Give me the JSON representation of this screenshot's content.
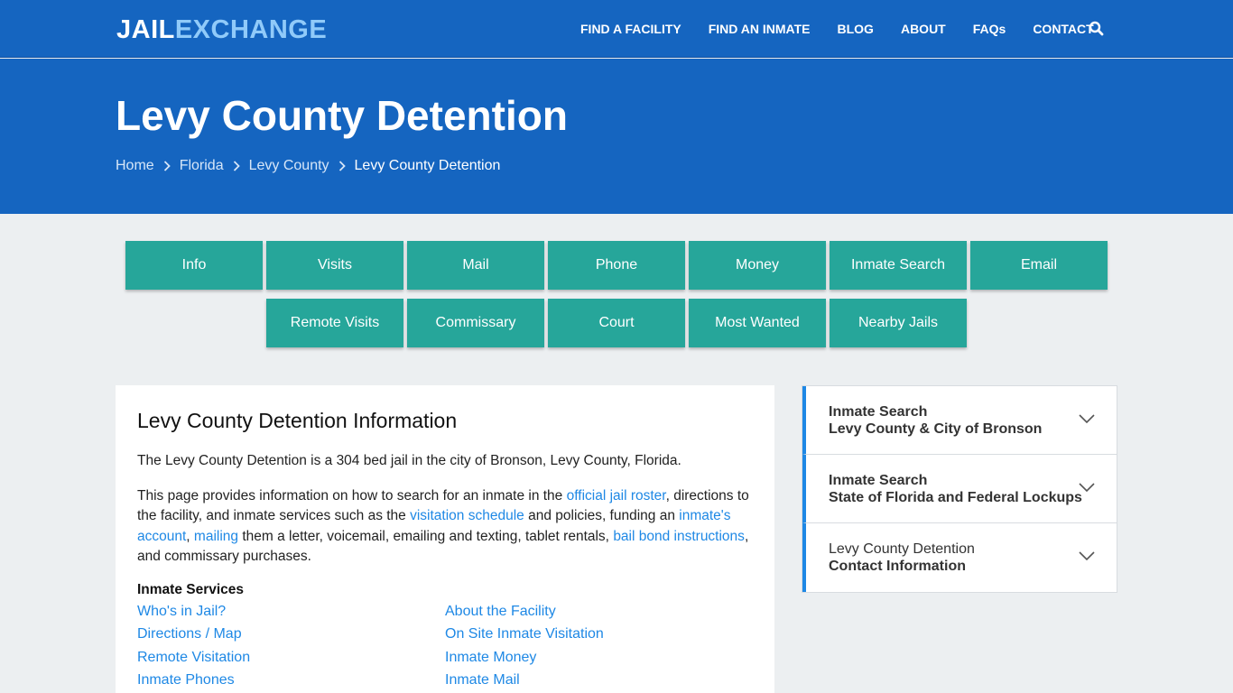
{
  "header": {
    "logo_part1": "JAIL",
    "logo_part2": "EXCHANGE",
    "nav": [
      "FIND A FACILITY",
      "FIND AN INMATE",
      "BLOG",
      "ABOUT",
      "FAQs",
      "CONTACT"
    ],
    "search_icon": "search-icon"
  },
  "hero": {
    "title": "Levy County Detention",
    "breadcrumbs": [
      "Home",
      "Florida",
      "Levy County",
      "Levy County Detention"
    ]
  },
  "tabs": {
    "row1": [
      "Info",
      "Visits",
      "Mail",
      "Phone",
      "Money",
      "Inmate Search",
      "Email"
    ],
    "row2": [
      "Remote Visits",
      "Commissary",
      "Court",
      "Most Wanted",
      "Nearby Jails"
    ]
  },
  "main": {
    "heading": "Levy County Detention Information",
    "para1": "The Levy County Detention is a 304 bed jail in the city of Bronson, Levy County, Florida.",
    "para2": {
      "t1": "This page provides information on how to search for an inmate in the ",
      "l1": "official jail roster",
      "t2": ", directions to the facility, and inmate services such as the ",
      "l2": "visitation schedule",
      "t3": " and policies, funding an ",
      "l3": "inmate's account",
      "t4": ", ",
      "l4": "mailing",
      "t5": " them a letter, voicemail, emailing and texting, tablet rentals, ",
      "l5": "bail bond instructions",
      "t6": ", and commissary purchases."
    },
    "services_title": "Inmate Services",
    "services": [
      "Who's in Jail?",
      "About the Facility",
      "Directions / Map",
      "On Site Inmate Visitation",
      "Remote Visitation",
      "Inmate Money",
      "Inmate Phones",
      "Inmate Mail"
    ]
  },
  "sidebar": {
    "items": [
      {
        "line1": "Inmate Search",
        "line2": "Levy County & City of Bronson"
      },
      {
        "line1": "Inmate Search",
        "line2": "State of Florida and Federal Lockups"
      },
      {
        "line1": "Levy County Detention",
        "line2": "Contact Information"
      }
    ]
  },
  "colors": {
    "brand_blue": "#1565c0",
    "logo_accent": "#90caf9",
    "tab_teal": "#26a69a",
    "link_blue": "#1e88e5",
    "page_bg": "#eceff1"
  }
}
